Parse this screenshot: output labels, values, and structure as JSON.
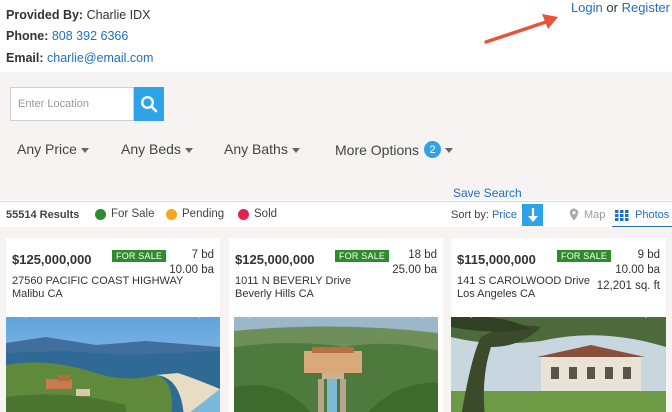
{
  "contact": {
    "provided_label": "Provided By:",
    "provided_value": "Charlie IDX",
    "phone_label": "Phone:",
    "phone_value": "808 392 6366",
    "email_label": "Email:",
    "email_value": "charlie@email.com"
  },
  "auth": {
    "login": "Login",
    "or": "or",
    "register": "Register"
  },
  "search": {
    "placeholder": "Enter Location",
    "icon": "search-icon"
  },
  "filters": {
    "price": "Any Price",
    "beds": "Any Beds",
    "baths": "Any Baths",
    "more": "More Options",
    "more_count": "2"
  },
  "save_search": "Save Search",
  "results": {
    "count": "55514 Results",
    "legend": [
      {
        "label": "For Sale",
        "color": "#2e8b2e"
      },
      {
        "label": "Pending",
        "color": "#f5a623"
      },
      {
        "label": "Sold",
        "color": "#e0234e"
      }
    ],
    "sort_label": "Sort by:",
    "sort_value": "Price",
    "view_map": "Map",
    "view_photos": "Photos"
  },
  "listings": [
    {
      "price": "$125,000,000",
      "status": "FOR SALE",
      "beds": "7 bd",
      "baths": "10.00 ba",
      "sqft": "",
      "address_line1": "27560 PACIFIC COAST HIGHWAY",
      "address_line2": "Malibu CA"
    },
    {
      "price": "$125,000,000",
      "status": "FOR SALE",
      "beds": "18 bd",
      "baths": "25.00 ba",
      "sqft": "",
      "address_line1": "1011 N BEVERLY Drive",
      "address_line2": "Beverly Hills CA"
    },
    {
      "price": "$115,000,000",
      "status": "FOR SALE",
      "beds": "9 bd",
      "baths": "10.00 ba",
      "sqft": "12,201 sq. ft",
      "address_line1": "141 S CAROLWOOD Drive",
      "address_line2": "Los Angeles CA"
    }
  ],
  "colors": {
    "accent": "#2ea3e8",
    "link": "#1f6fc5",
    "status_green": "#2e8b2e",
    "annotation_arrow": "#e8543a"
  }
}
